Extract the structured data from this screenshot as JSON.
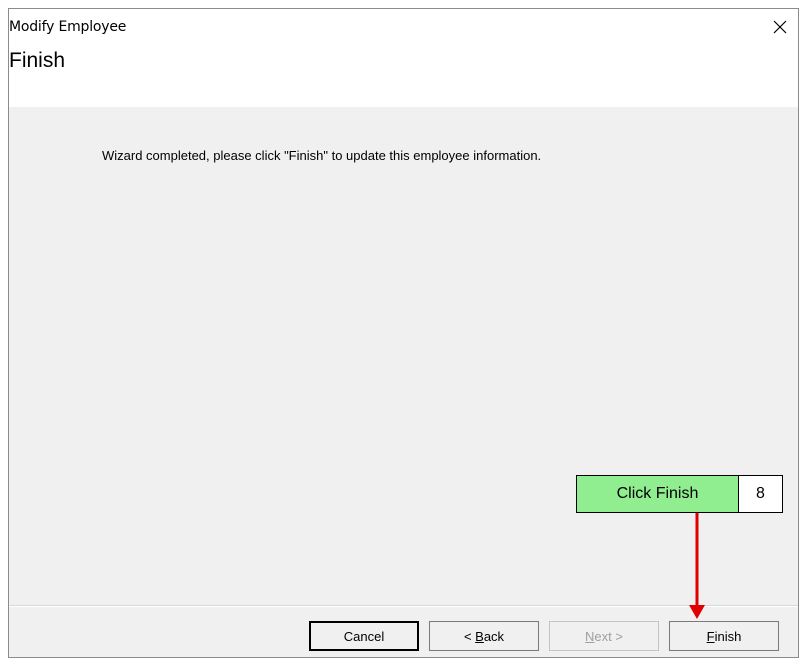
{
  "window": {
    "title": "Modify Employee",
    "close_icon": "close-icon"
  },
  "header": {
    "title": "Finish"
  },
  "content": {
    "message": "Wizard completed, please click \"Finish\" to update this employee information."
  },
  "buttons": {
    "cancel": "Cancel",
    "back_prefix": "< ",
    "back_mnemonic": "B",
    "back_rest": "ack",
    "next_mnemonic": "N",
    "next_rest": "ext >",
    "finish_mnemonic": "F",
    "finish_rest": "inish"
  },
  "callout": {
    "label": "Click Finish",
    "step": "8",
    "label_color": "#90ee90",
    "arrow_color": "#e00000"
  }
}
